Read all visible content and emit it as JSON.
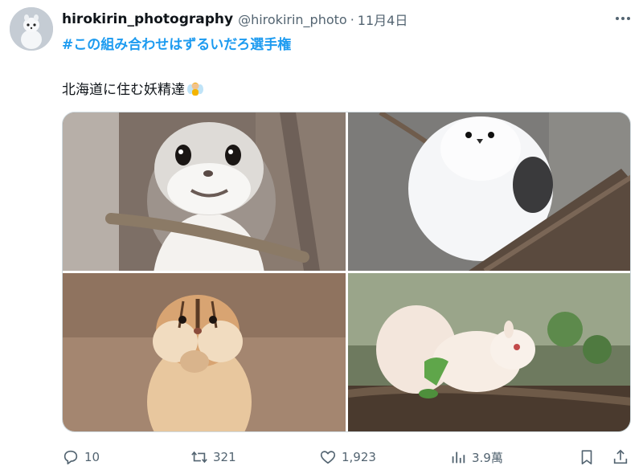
{
  "author": {
    "display_name": "hirokirin_photography",
    "handle": "@hirokirin_photo",
    "separator": "·",
    "date": "11月4日"
  },
  "tweet": {
    "hashtag": "#この組み合わせはずるいだろ選手権",
    "text": "北海道に住む妖精達",
    "emoji": "fairy-emoji"
  },
  "media": [
    {
      "subject": "flying-squirrel-photo"
    },
    {
      "subject": "long-tailed-tit-bird-photo"
    },
    {
      "subject": "chipmunk-photo"
    },
    {
      "subject": "white-squirrel-photo"
    }
  ],
  "actions": {
    "replies": "10",
    "reposts": "321",
    "likes": "1,923",
    "views": "3.9萬"
  },
  "colors": {
    "link": "#1d9bf0",
    "text": "#0f1419",
    "muted": "#536471",
    "border": "#cfd9de"
  }
}
